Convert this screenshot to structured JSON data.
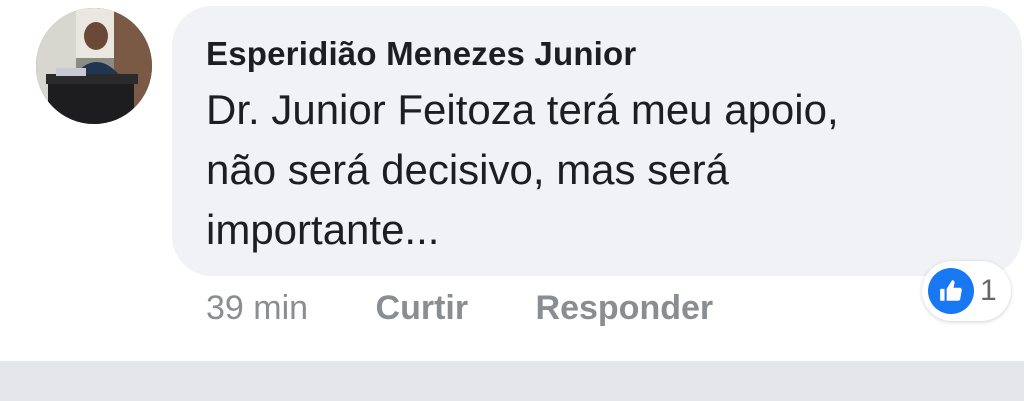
{
  "comment": {
    "author": "Esperidião Menezes Junior",
    "lines": [
      "Dr. Junior Feitoza terá meu apoio,",
      "não será decisivo, mas será",
      "importante..."
    ]
  },
  "actions": {
    "time": "39 min",
    "like_label": "Curtir",
    "reply_label": "Responder"
  },
  "reactions": {
    "icon": "like-thumb-icon",
    "count": "1"
  },
  "colors": {
    "bubble": "#f0f2f5",
    "like_blue": "#1877f2",
    "muted_text": "#8a8d91"
  }
}
